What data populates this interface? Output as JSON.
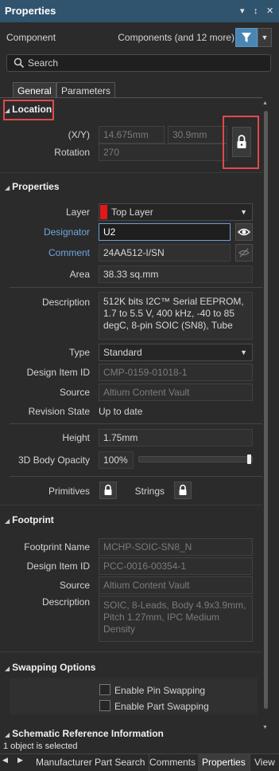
{
  "window": {
    "title": "Properties",
    "controls": [
      "▾",
      "↕",
      "✕"
    ]
  },
  "component_row": {
    "label": "Component",
    "value": "Components (and 12 more)"
  },
  "search": {
    "placeholder": "Search"
  },
  "tabs": [
    {
      "label": "General"
    },
    {
      "label": "Parameters"
    }
  ],
  "location": {
    "header": "Location",
    "xy_label": "(X/Y)",
    "x_value": "14.675mm",
    "y_value": "30.9mm",
    "rotation_label": "Rotation",
    "rotation_value": "270"
  },
  "properties": {
    "header": "Properties",
    "layer_label": "Layer",
    "layer_value": "Top Layer",
    "designator_label": "Designator",
    "designator_value": "U2",
    "comment_label": "Comment",
    "comment_value": "24AA512-I/SN",
    "area_label": "Area",
    "area_value": "38.33 sq.mm",
    "description_label": "Description",
    "description_value": "512K bits I2C™ Serial EEPROM, 1.7 to 5.5 V, 400 kHz, -40 to 85 degC, 8-pin SOIC (SN8), Tube",
    "type_label": "Type",
    "type_value": "Standard",
    "design_item_label": "Design Item ID",
    "design_item_value": "CMP-0159-01018-1",
    "source_label": "Source",
    "source_value": "Altium Content Vault",
    "revision_label": "Revision State",
    "revision_value": "Up to date",
    "height_label": "Height",
    "height_value": "1.75mm",
    "opacity_label": "3D Body Opacity",
    "opacity_value": "100%",
    "opacity_fraction": 1.0,
    "primitives_label": "Primitives",
    "strings_label": "Strings"
  },
  "footprint": {
    "header": "Footprint",
    "name_label": "Footprint Name",
    "name_value": "MCHP-SOIC-SN8_N",
    "design_item_label": "Design Item ID",
    "design_item_value": "PCC-0016-00354-1",
    "source_label": "Source",
    "source_value": "Altium Content Vault",
    "description_label": "Description",
    "description_value": "SOIC, 8-Leads, Body 4.9x3.9mm, Pitch 1.27mm, IPC Medium Density"
  },
  "swapping": {
    "header": "Swapping Options",
    "pin_label": "Enable Pin Swapping",
    "part_label": "Enable Part Swapping"
  },
  "schematic": {
    "header": "Schematic Reference Information"
  },
  "status": {
    "text": "1 object is selected"
  },
  "bottom_tabs": [
    {
      "label": "Manufacturer Part Search"
    },
    {
      "label": "Comments"
    },
    {
      "label": "Properties"
    },
    {
      "label": "View"
    }
  ],
  "colors": {
    "accent": "#4a86b4",
    "highlight": "#e04a4a",
    "layer_swatch": "#e01818"
  }
}
